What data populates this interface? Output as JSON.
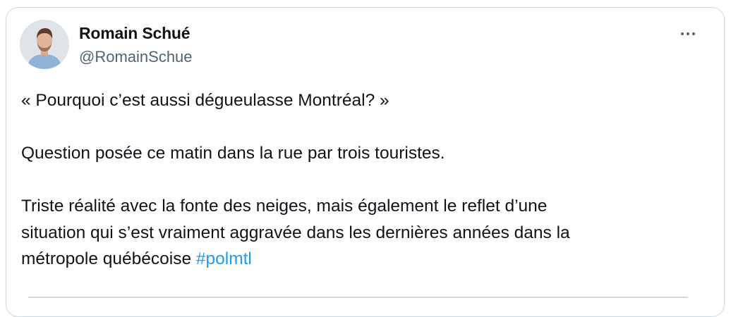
{
  "author": {
    "name": "Romain Schué",
    "handle": "@RomainSchue",
    "avatar_icon": "person-avatar"
  },
  "more_icon": "more-horizontal-icon",
  "tweet": {
    "line1": "« Pourquoi c’est aussi dégueulasse Montréal? »",
    "line2": "Question posée ce matin dans la rue par trois touristes.",
    "line3a": "Triste réalité avec la fonte des neiges, mais également le reflet d’une",
    "line3b": "situation qui s’est vraiment aggravée dans les dernières années dans la",
    "line3c": "métropole québécoise",
    "hashtag": "#polmtl"
  },
  "colors": {
    "text": "#0f1419",
    "secondary": "#536471",
    "link": "#1d9bf0",
    "border": "#cfd9de"
  }
}
